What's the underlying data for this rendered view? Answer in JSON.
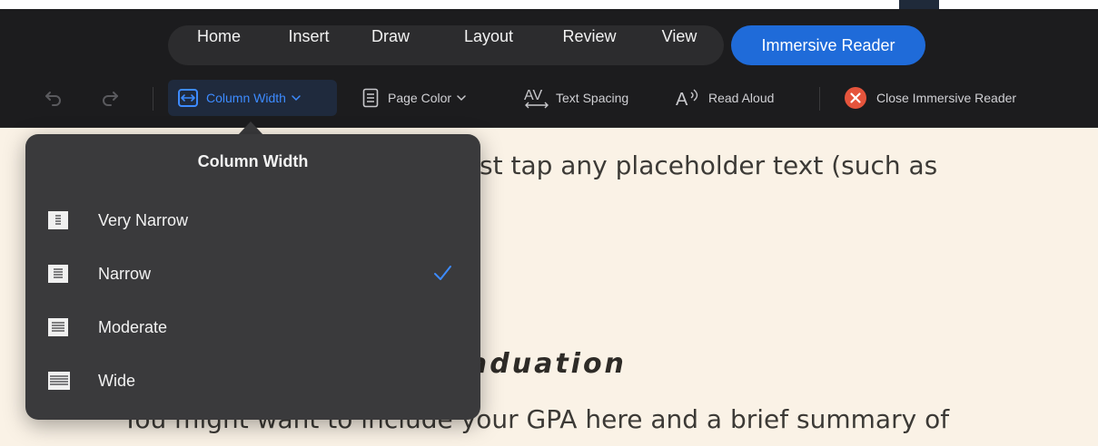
{
  "tabs": {
    "items": [
      "Home",
      "Insert",
      "Draw",
      "Layout",
      "Review",
      "View"
    ],
    "active": "Immersive Reader"
  },
  "toolbar": {
    "undo_icon": "undo-icon",
    "redo_icon": "redo-icon",
    "column_width": "Column Width",
    "page_color": "Page Color",
    "text_spacing": "Text Spacing",
    "read_aloud": "Read Aloud",
    "close_reader": "Close Immersive Reader",
    "accent_color": "#3d8bff",
    "close_color": "#e5543c"
  },
  "document": {
    "line1": "st tap any placeholder text (such as",
    "heading": "aduation",
    "line2": "You might want to include your GPA here and a brief summary of"
  },
  "column_width_menu": {
    "title": "Column Width",
    "options": [
      {
        "label": "Very Narrow",
        "selected": false
      },
      {
        "label": "Narrow",
        "selected": true
      },
      {
        "label": "Moderate",
        "selected": false
      },
      {
        "label": "Wide",
        "selected": false
      }
    ]
  }
}
